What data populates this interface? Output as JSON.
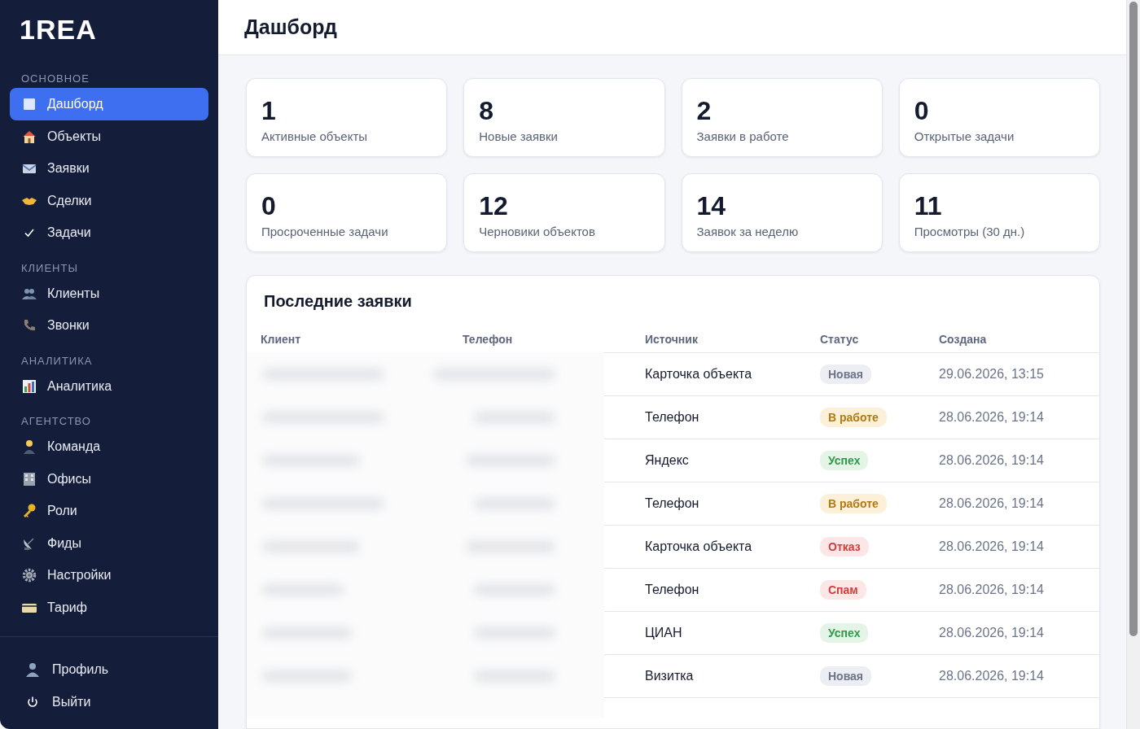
{
  "logo": {
    "text": "1REA"
  },
  "sidebar": {
    "sections": [
      {
        "label": "ОСНОВНОЕ",
        "items": [
          {
            "label": "Дашборд",
            "selected": true
          },
          {
            "label": "Объекты",
            "selected": false
          },
          {
            "label": "Заявки",
            "selected": false
          },
          {
            "label": "Сделки",
            "selected": false
          },
          {
            "label": "Задачи",
            "selected": false
          }
        ]
      },
      {
        "label": "КЛИЕНТЫ",
        "items": [
          {
            "label": "Клиенты",
            "selected": false
          },
          {
            "label": "Звонки",
            "selected": false
          }
        ]
      },
      {
        "label": "АНАЛИТИКА",
        "items": [
          {
            "label": "Аналитика",
            "selected": false
          }
        ]
      },
      {
        "label": "АГЕНТСТВО",
        "items": [
          {
            "label": "Команда",
            "selected": false
          },
          {
            "label": "Офисы",
            "selected": false
          },
          {
            "label": "Роли",
            "selected": false
          },
          {
            "label": "Фиды",
            "selected": false
          },
          {
            "label": "Настройки",
            "selected": false
          },
          {
            "label": "Тариф",
            "selected": false
          }
        ]
      }
    ],
    "footer": [
      {
        "label": "Профиль"
      },
      {
        "label": "Выйти"
      }
    ]
  },
  "page": {
    "title": "Дашборд"
  },
  "stats": [
    {
      "value": "1",
      "label": "Активные объекты"
    },
    {
      "value": "8",
      "label": "Новые заявки"
    },
    {
      "value": "2",
      "label": "Заявки в работе"
    },
    {
      "value": "0",
      "label": "Открытые задачи"
    },
    {
      "value": "0",
      "label": "Просроченные задачи"
    },
    {
      "value": "12",
      "label": "Черновики объектов"
    },
    {
      "value": "14",
      "label": "Заявок за неделю"
    },
    {
      "value": "11",
      "label": "Просмотры (30 дн.)"
    }
  ],
  "recent": {
    "title": "Последние заявки",
    "columns": [
      "Клиент",
      "Телефон",
      "Источник",
      "Статус",
      "Создана"
    ],
    "rows": [
      {
        "source": "Карточка объекта",
        "status": {
          "label": "Новая",
          "kind": "new"
        },
        "created": "29.06.2026, 13:15"
      },
      {
        "source": "Телефон",
        "status": {
          "label": "В работе",
          "kind": "work"
        },
        "created": "28.06.2026, 19:14"
      },
      {
        "source": "Яндекс",
        "status": {
          "label": "Успех",
          "kind": "success"
        },
        "created": "28.06.2026, 19:14"
      },
      {
        "source": "Телефон",
        "status": {
          "label": "В работе",
          "kind": "work"
        },
        "created": "28.06.2026, 19:14"
      },
      {
        "source": "Карточка объекта",
        "status": {
          "label": "Отказ",
          "kind": "reject"
        },
        "created": "28.06.2026, 19:14"
      },
      {
        "source": "Телефон",
        "status": {
          "label": "Спам",
          "kind": "spam"
        },
        "created": "28.06.2026, 19:14"
      },
      {
        "source": "ЦИАН",
        "status": {
          "label": "Успех",
          "kind": "success"
        },
        "created": "28.06.2026, 19:14"
      },
      {
        "source": "Визитка",
        "status": {
          "label": "Новая",
          "kind": "new"
        },
        "created": "28.06.2026, 19:14"
      }
    ]
  }
}
